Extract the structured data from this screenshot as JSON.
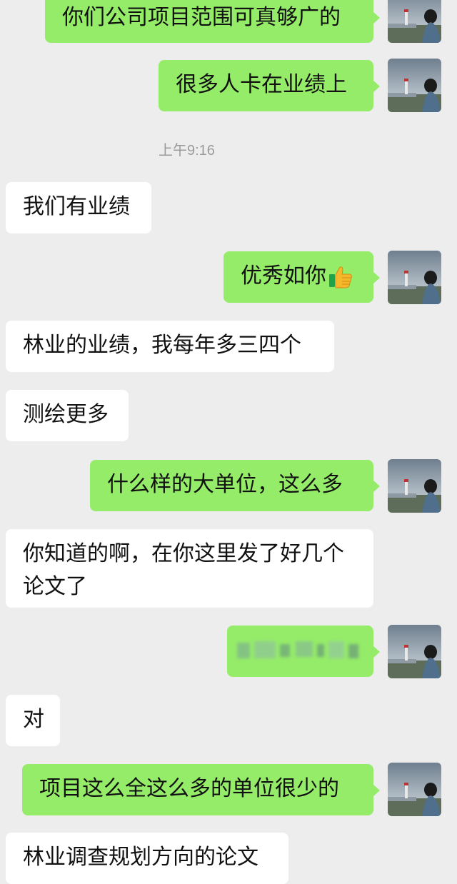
{
  "chat": {
    "messages": [
      {
        "side": "out",
        "text": "你们公司项目范围可真够广的"
      },
      {
        "side": "out",
        "text": "很多人卡在业绩上"
      },
      {
        "side": "time",
        "text": "上午9:16"
      },
      {
        "side": "in",
        "text": "我们有业绩"
      },
      {
        "side": "out",
        "text": "优秀如你"
      },
      {
        "side": "in",
        "text": "林业的业绩，我每年多三四个"
      },
      {
        "side": "in",
        "text": "测绘更多"
      },
      {
        "side": "out",
        "text": "什么样的大单位，这么多"
      },
      {
        "side": "in",
        "text": "你知道的啊，在你这里发了好几个论文了"
      },
      {
        "side": "out",
        "text": ""
      },
      {
        "side": "in",
        "text": "对"
      },
      {
        "side": "out",
        "text": "项目这么全这么多的单位很少的"
      },
      {
        "side": "in",
        "text": "林业调查规划方向的论文"
      }
    ]
  },
  "icons": {
    "thumbs_up": "thumbs-up-emoji",
    "avatar": "avatar-lighthouse-landscape"
  },
  "colors": {
    "background": "#ededed",
    "outgoing_bubble": "#95ec69",
    "incoming_bubble": "#ffffff",
    "timestamp": "#9a9a9a"
  }
}
